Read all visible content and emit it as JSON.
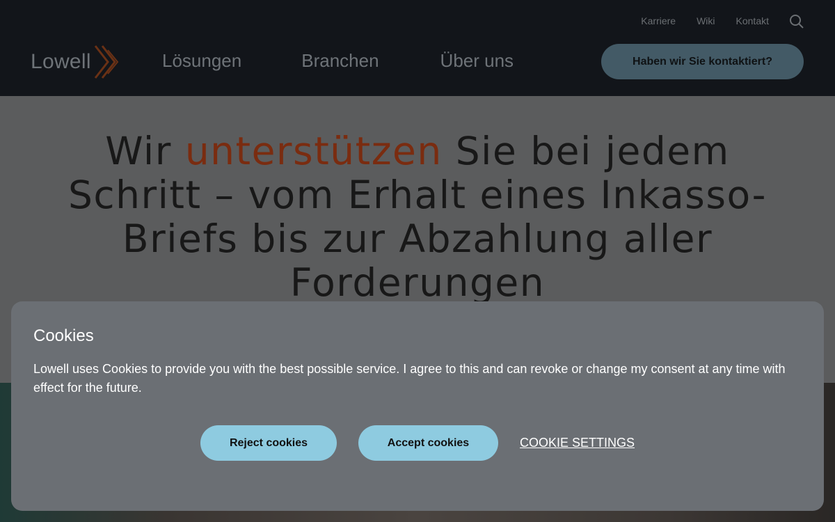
{
  "header": {
    "utility_nav": [
      "Karriere",
      "Wiki",
      "Kontakt"
    ],
    "logo_text": "Lowell",
    "main_nav": [
      "Lösungen",
      "Branchen",
      "Über uns"
    ],
    "cta_label": "Haben wir Sie kontaktiert?",
    "icons": {
      "search": "search-icon",
      "logo_mark": "chevron-logo-icon"
    }
  },
  "hero": {
    "headline_before": "Wir ",
    "headline_accent": "unterstützen",
    "headline_after": " Sie bei jedem Schritt – vom Erhalt eines Inkasso-Briefs bis zur Abzahlung aller Forderungen"
  },
  "cookie_banner": {
    "title": "Cookies",
    "text": "Lowell uses Cookies to provide you with the best possible service. I agree to this and can revoke or change my consent at any time with effect for the future.",
    "reject_label": "Reject cookies",
    "accept_label": "Accept cookies",
    "settings_label": "COOKIE SETTINGS"
  },
  "colors": {
    "accent_orange": "#e8541c",
    "button_blue": "#8ecbe0",
    "modal_bg": "#6b6f74"
  }
}
